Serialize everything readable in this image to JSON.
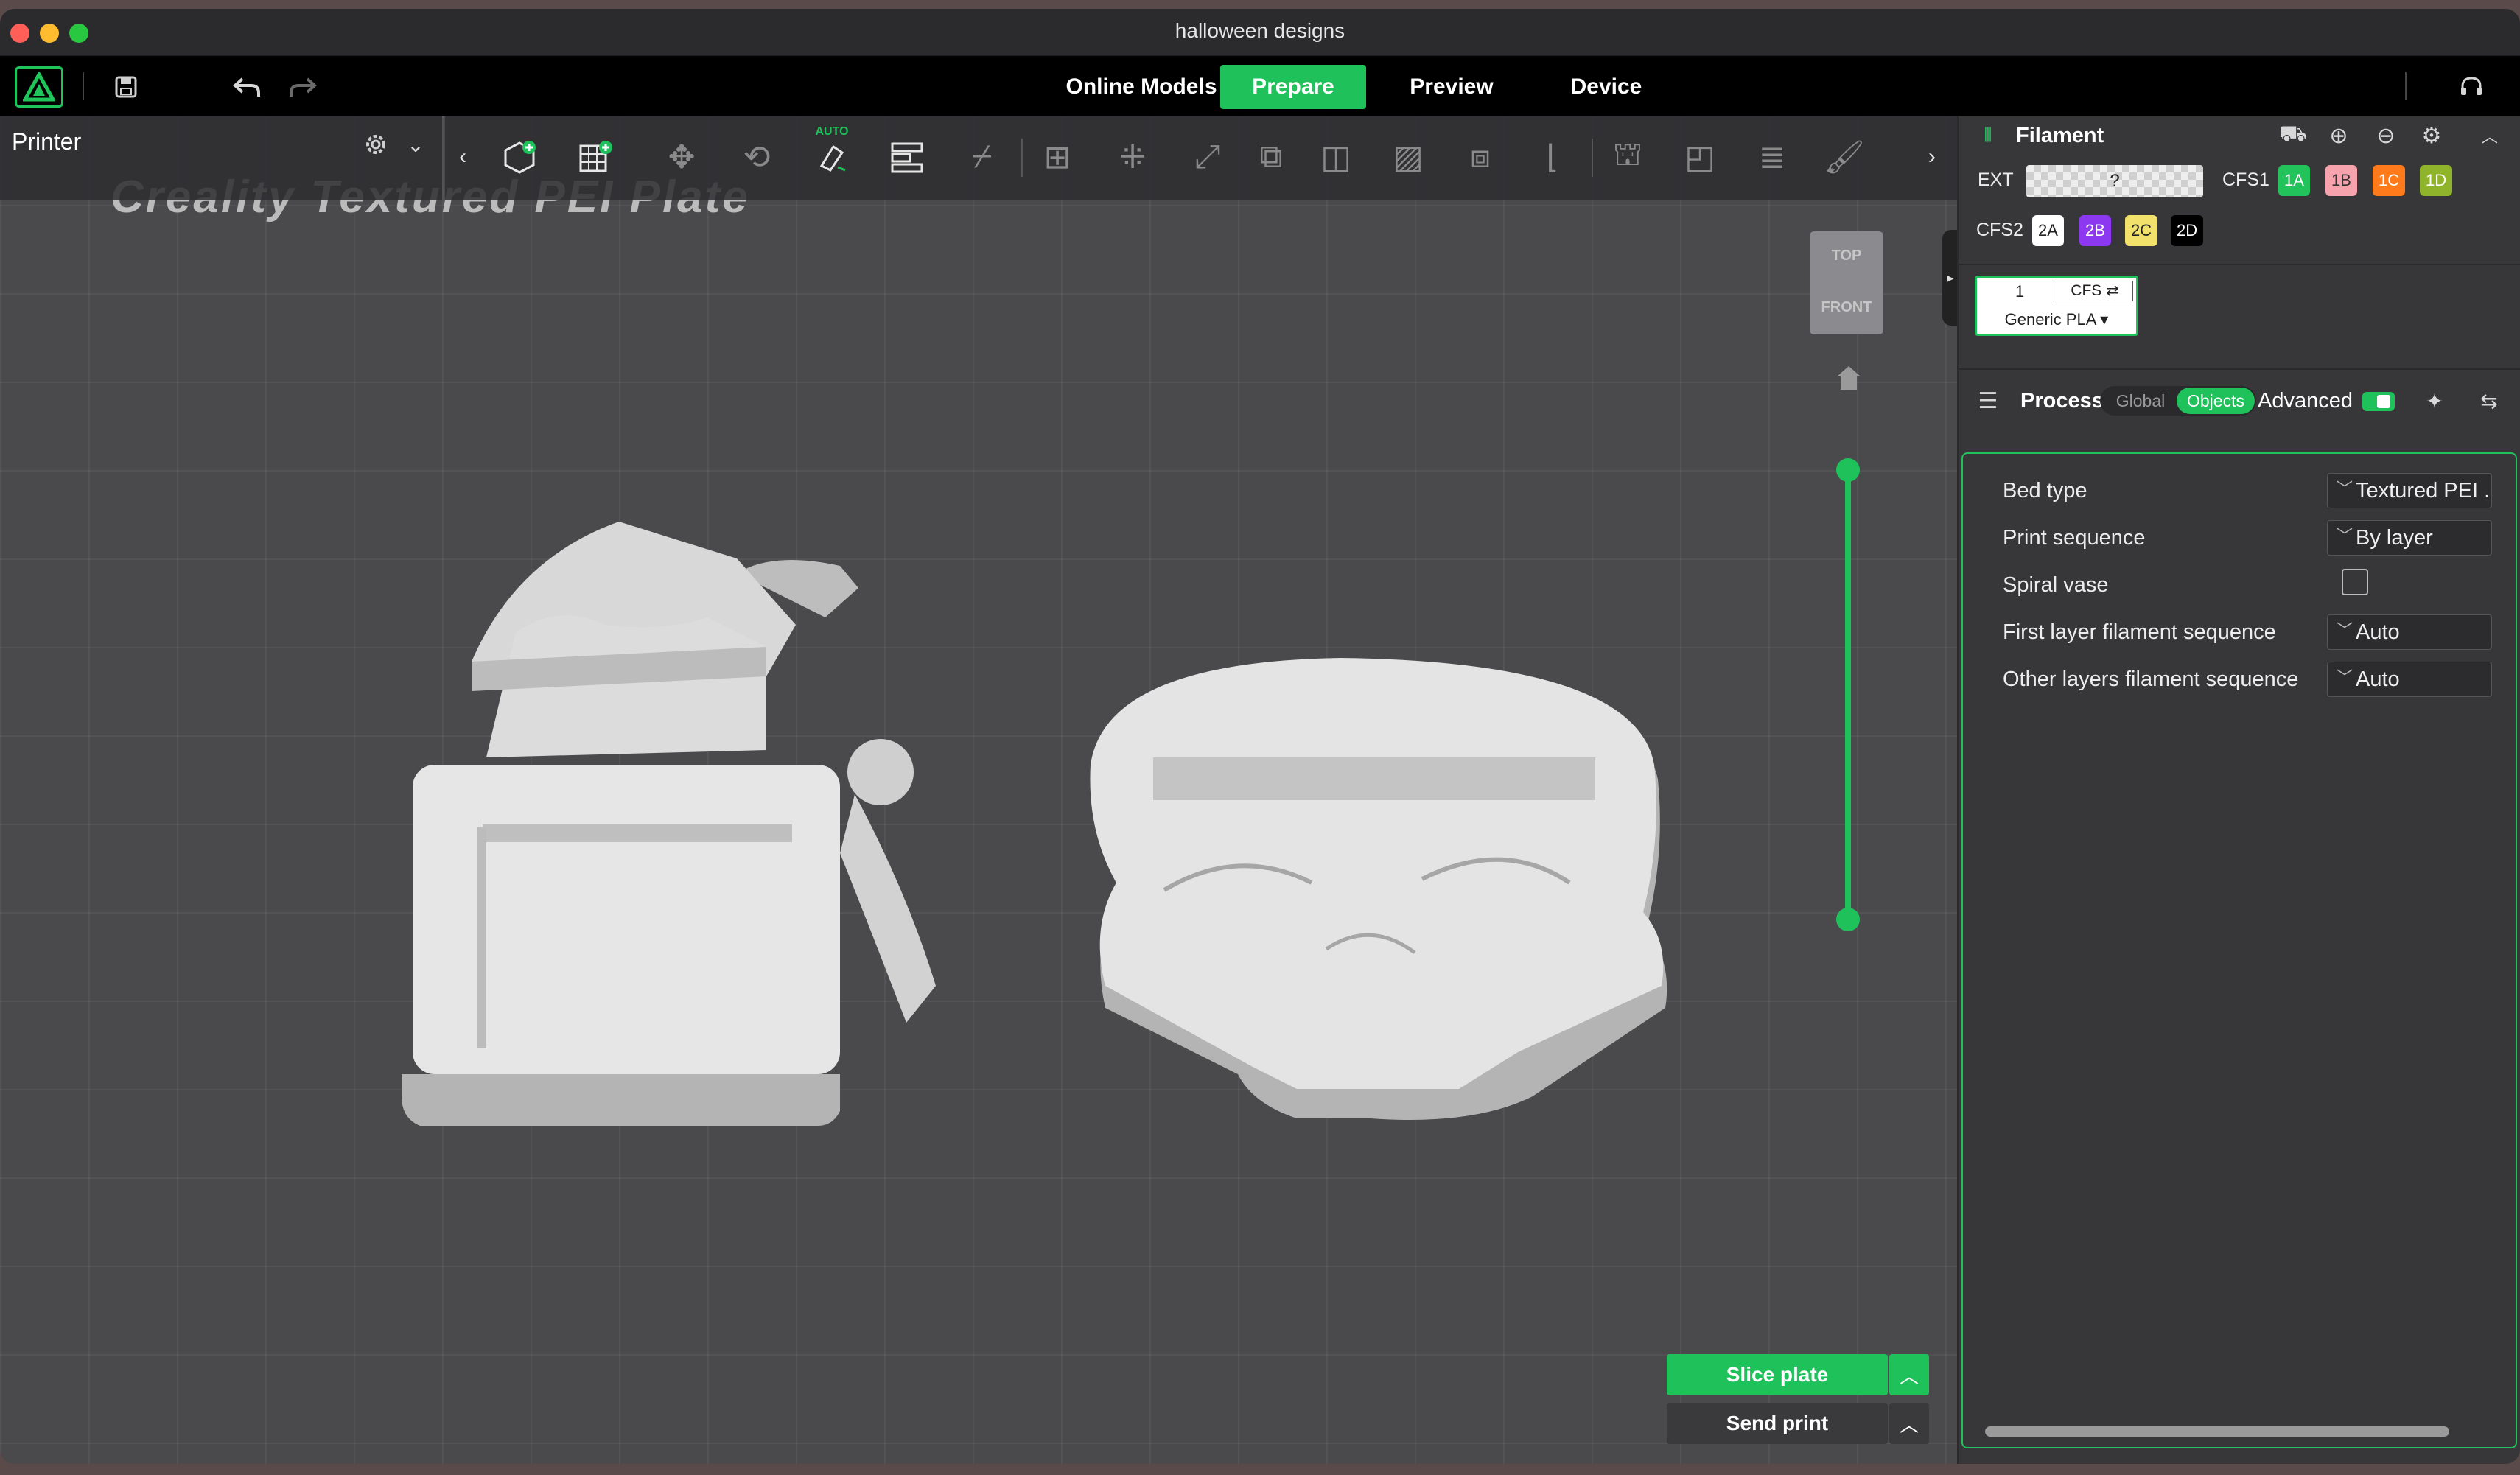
{
  "window": {
    "title": "halloween designs"
  },
  "menubar": {
    "tabs": [
      {
        "label": "Online Models",
        "active": false
      },
      {
        "label": "Prepare",
        "active": true
      },
      {
        "label": "Preview",
        "active": false
      },
      {
        "label": "Device",
        "active": false
      }
    ]
  },
  "printer": {
    "label": "Printer"
  },
  "plate": {
    "name": "Creality Textured PEI Plate"
  },
  "toolbar": {
    "auto_label": "AUTO"
  },
  "viewcube": {
    "top": "TOP",
    "front": "FRONT"
  },
  "filament": {
    "title": "Filament",
    "ext_label": "EXT",
    "ext_value": "?",
    "cfs1_label": "CFS1",
    "cfs1_slots": [
      {
        "label": "1A",
        "color": "#22c35a",
        "text_color": "#ffffff"
      },
      {
        "label": "1B",
        "color": "#f7a3ad",
        "text_color": "#333333"
      },
      {
        "label": "1C",
        "color": "#ff7a1a",
        "text_color": "#ffffff"
      },
      {
        "label": "1D",
        "color": "#8fb32a",
        "text_color": "#ffffff"
      }
    ],
    "cfs2_label": "CFS2",
    "cfs2_slots": [
      {
        "label": "2A",
        "color": "#ffffff",
        "text_color": "#222222"
      },
      {
        "label": "2B",
        "color": "#8b38f0",
        "text_color": "#ffffff"
      },
      {
        "label": "2C",
        "color": "#f2e26b",
        "text_color": "#222222"
      },
      {
        "label": "2D",
        "color": "#000000",
        "text_color": "#ffffff"
      }
    ],
    "slot_number": "1",
    "slot_source": "CFS ⇄",
    "material": "Generic PLA ▾"
  },
  "process": {
    "title": "Process",
    "mode_global": "Global",
    "mode_objects": "Objects",
    "advanced_label": "Advanced",
    "settings": [
      {
        "label": "Bed type",
        "value": "Textured PEI ..",
        "kind": "select"
      },
      {
        "label": "Print sequence",
        "value": "By layer",
        "kind": "select"
      },
      {
        "label": "Spiral vase",
        "value": "",
        "kind": "checkbox"
      },
      {
        "label": "First layer filament sequence",
        "value": "Auto",
        "kind": "select"
      },
      {
        "label": "Other layers filament sequence",
        "value": "Auto",
        "kind": "select"
      }
    ]
  },
  "actions": {
    "slice": "Slice plate",
    "send": "Send print"
  },
  "colors": {
    "accent": "#1ec15a",
    "panel": "#37373a",
    "viewport": "#4a4a4d"
  }
}
